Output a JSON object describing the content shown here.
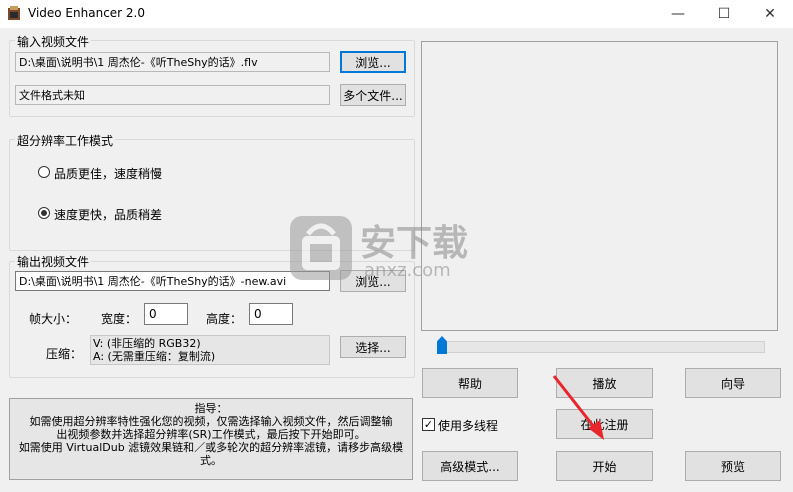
{
  "window": {
    "title": "Video Enhancer 2.0",
    "minimize": "—",
    "maximize": "☐",
    "close": "✕"
  },
  "input_group": {
    "legend": "输入视频文件",
    "path": "D:\\桌面\\说明书\\1 周杰伦-《听TheShy的话》.flv",
    "browse_label": "浏览...",
    "format_text": "文件格式未知",
    "multi_label": "多个文件..."
  },
  "mode_group": {
    "legend": "超分辨率工作模式",
    "option_quality": "品质更佳，速度稍慢",
    "option_speed": "速度更快，品质稍差",
    "selected": "speed"
  },
  "output_group": {
    "legend": "输出视频文件",
    "path": "D:\\桌面\\说明书\\1 周杰伦-《听TheShy的话》-new.avi",
    "browse_label": "浏览...",
    "frame_size_label": "帧大小：",
    "width_label": "宽度：",
    "width_value": "0",
    "height_label": "高度：",
    "height_value": "0",
    "compress_label": "压缩：",
    "compress_v": "V: (非压缩的 RGB32)",
    "compress_a": "A: (无需重压缩：复制流)",
    "select_label": "选择..."
  },
  "guide": {
    "title": "指导：",
    "line1": "如需使用超分辨率特性强化您的视频，仅需选择输入视频文件，然后调整输",
    "line2": "出视频参数并选择超分辨率(SR)工作模式，最后按下开始即可。",
    "line3": "如需使用 VirtualDub 滤镜效果链和／或多轮次的超分辨率滤镜，请移步高级模",
    "line4": "式。"
  },
  "buttons": {
    "help": "帮助",
    "play": "播放",
    "wizard": "向导",
    "register": "在此注册",
    "advanced": "高级模式...",
    "start": "开始",
    "preview": "预览"
  },
  "multithread": {
    "label": "使用多线程",
    "checked": true
  },
  "slider": {
    "position": 0.0
  },
  "watermark": {
    "text": "安下载",
    "sub": "anxz.com"
  },
  "colors": {
    "accent": "#0078d7",
    "annotation_arrow": "#e8262b"
  }
}
